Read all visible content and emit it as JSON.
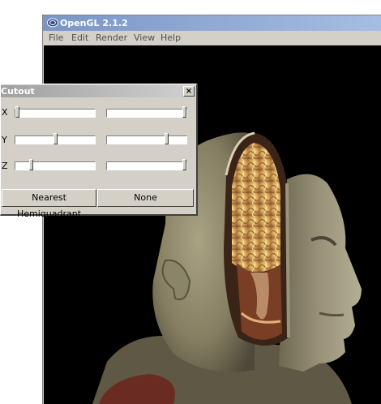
{
  "main_window": {
    "title": "OpenGL 2.1.2",
    "menu": [
      "File",
      "Edit",
      "Render",
      "View",
      "Help"
    ]
  },
  "cutout": {
    "title": "Cutout",
    "close_glyph": "×",
    "axes": [
      {
        "label": "X",
        "min_value": 0.0,
        "max_value": 1.0
      },
      {
        "label": "Y",
        "min_value": 0.5,
        "max_value": 0.8
      },
      {
        "label": "Z",
        "min_value": 0.2,
        "max_value": 1.0
      }
    ],
    "mode_button": "Nearest Hemiquadrant",
    "none_button": "None"
  },
  "icons": {
    "app": "opengl-app-icon",
    "close": "close-icon"
  }
}
